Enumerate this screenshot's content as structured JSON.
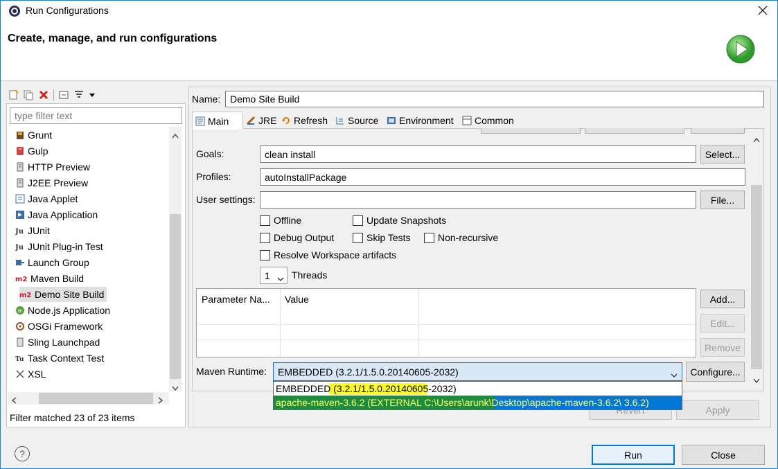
{
  "window": {
    "title": "Run Configurations",
    "header_title": "Create, manage, and run configurations"
  },
  "left": {
    "filter_placeholder": "type filter text",
    "items": [
      {
        "label": "Grunt",
        "icon": "grunt-icon"
      },
      {
        "label": "Gulp",
        "icon": "gulp-icon"
      },
      {
        "label": "HTTP Preview",
        "icon": "http-preview-icon"
      },
      {
        "label": "J2EE Preview",
        "icon": "j2ee-preview-icon"
      },
      {
        "label": "Java Applet",
        "icon": "java-applet-icon"
      },
      {
        "label": "Java Application",
        "icon": "java-application-icon"
      },
      {
        "label": "JUnit",
        "icon": "junit-icon"
      },
      {
        "label": "JUnit Plug-in Test",
        "icon": "junit-plugin-icon"
      },
      {
        "label": "Launch Group",
        "icon": "launch-group-icon"
      },
      {
        "label": "Maven Build",
        "icon": "maven-icon"
      },
      {
        "label": "Demo Site Build",
        "icon": "maven-icon",
        "child": true,
        "selected": true
      },
      {
        "label": "Node.js Application",
        "icon": "nodejs-icon"
      },
      {
        "label": "OSGi Framework",
        "icon": "osgi-icon"
      },
      {
        "label": "Sling Launchpad",
        "icon": "sling-icon"
      },
      {
        "label": "Task Context Test",
        "icon": "task-context-icon"
      },
      {
        "label": "XSL",
        "icon": "xsl-icon"
      }
    ],
    "status": "Filter matched 23 of 23 items"
  },
  "config": {
    "name_label": "Name:",
    "name_value": "Demo Site Build",
    "tabs": [
      "Main",
      "JRE",
      "Refresh",
      "Source",
      "Environment",
      "Common"
    ],
    "goals_label": "Goals:",
    "goals_value": "clean install",
    "select_btn": "Select...",
    "profiles_label": "Profiles:",
    "profiles_value": "autoInstallPackage",
    "user_settings_label": "User settings:",
    "user_settings_value": "",
    "file_btn": "File...",
    "checkboxes": {
      "offline": "Offline",
      "update_snapshots": "Update Snapshots",
      "debug_output": "Debug Output",
      "skip_tests": "Skip Tests",
      "non_recursive": "Non-recursive",
      "resolve_workspace": "Resolve Workspace artifacts"
    },
    "threads_value": "1",
    "threads_label": "Threads",
    "param_headers": [
      "Parameter Na...",
      "Value"
    ],
    "add_btn": "Add...",
    "edit_btn": "Edit...",
    "remove_btn": "Remove",
    "runtime_label": "Maven Runtime:",
    "runtime_value": "EMBEDDED (3.2.1/1.5.0.20140605-2032)",
    "configure_btn": "Configure...",
    "runtime_options": [
      "EMBEDDED (3.2.1/1.5.0.20140605-2032)",
      "apache-maven-3.6.2 (EXTERNAL C:\\Users\\arunk\\Desktop\\apache-maven-3.6.2\\ 3.6.2)"
    ],
    "revert_btn": "Revert",
    "apply_btn": "Apply"
  },
  "footer": {
    "help_icon": "?",
    "run_btn": "Run",
    "close_btn": "Close"
  },
  "colors": {
    "accent": "#0078d7",
    "highlight": "#ffff00",
    "run_green": "#3cab3c"
  }
}
